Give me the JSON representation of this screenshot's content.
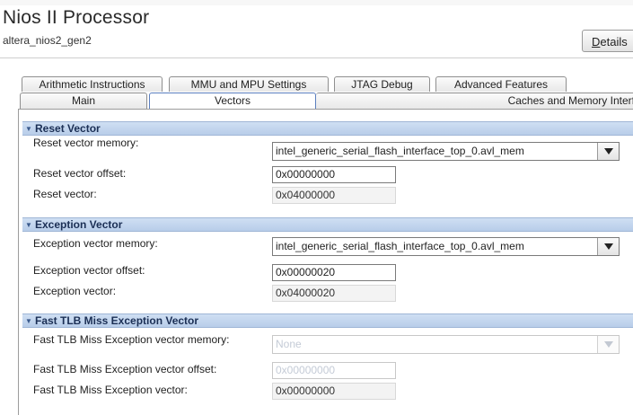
{
  "header": {
    "title": "Nios II Processor",
    "subtitle": "altera_nios2_gen2",
    "details_prefix": "D",
    "details_rest": "etails"
  },
  "tabs_row1": [
    "Arithmetic Instructions",
    "MMU and MPU Settings",
    "JTAG Debug",
    "Advanced Features"
  ],
  "tabs_row2": [
    "Main",
    "Vectors",
    "Caches and Memory Interf"
  ],
  "active_tab": "Vectors",
  "sections": {
    "reset": {
      "title": "Reset Vector",
      "memory_label": "Reset vector memory:",
      "memory_value": "intel_generic_serial_flash_interface_top_0.avl_mem",
      "offset_label": "Reset vector offset:",
      "offset_value": "0x00000000",
      "vector_label": "Reset vector:",
      "vector_value": "0x04000000"
    },
    "exception": {
      "title": "Exception Vector",
      "memory_label": "Exception vector memory:",
      "memory_value": "intel_generic_serial_flash_interface_top_0.avl_mem",
      "offset_label": "Exception vector offset:",
      "offset_value": "0x00000020",
      "vector_label": "Exception vector:",
      "vector_value": "0x04000020"
    },
    "tlb": {
      "title": "Fast TLB Miss Exception Vector",
      "memory_label": "Fast TLB Miss Exception vector memory:",
      "memory_value": "None",
      "offset_label": "Fast TLB Miss Exception vector offset:",
      "offset_value": "0x00000000",
      "vector_label": "Fast TLB Miss Exception vector:",
      "vector_value": "0x00000000"
    }
  },
  "colors": {
    "section_header": "#c3d5ee",
    "active_tab_border": "#5b7fbf"
  },
  "icons": {
    "collapse": "triangle-down-icon",
    "dropdown": "chevron-down-icon"
  }
}
